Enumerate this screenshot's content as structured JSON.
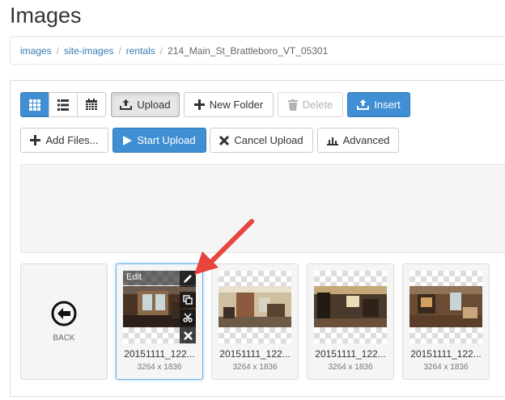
{
  "page": {
    "title": "Images"
  },
  "breadcrumb": {
    "items": [
      "images",
      "site-images",
      "rentals"
    ],
    "current": "214_Main_St_Brattleboro_VT_05301"
  },
  "toolbar": {
    "view_icons": [
      "grid-icon",
      "list-icon",
      "calendar-icon"
    ],
    "upload": "Upload",
    "new_folder": "New Folder",
    "delete": "Delete",
    "insert": "Insert"
  },
  "upload_bar": {
    "add_files": "Add Files...",
    "start_upload": "Start Upload",
    "cancel_upload": "Cancel Upload",
    "advanced": "Advanced"
  },
  "back_tile": {
    "label": "BACK"
  },
  "selected_tile_overlay": {
    "edit_label": "Edit"
  },
  "files": [
    {
      "name": "20151111_122...",
      "dims": "3264 x 1836"
    },
    {
      "name": "20151111_122...",
      "dims": "3264 x 1836"
    },
    {
      "name": "20151111_122...",
      "dims": "3264 x 1836"
    },
    {
      "name": "20151111_122...",
      "dims": "3264 x 1836"
    }
  ],
  "colors": {
    "primary": "#3f8fd2",
    "link": "#337ab7",
    "annotation_arrow": "#e8433c"
  }
}
